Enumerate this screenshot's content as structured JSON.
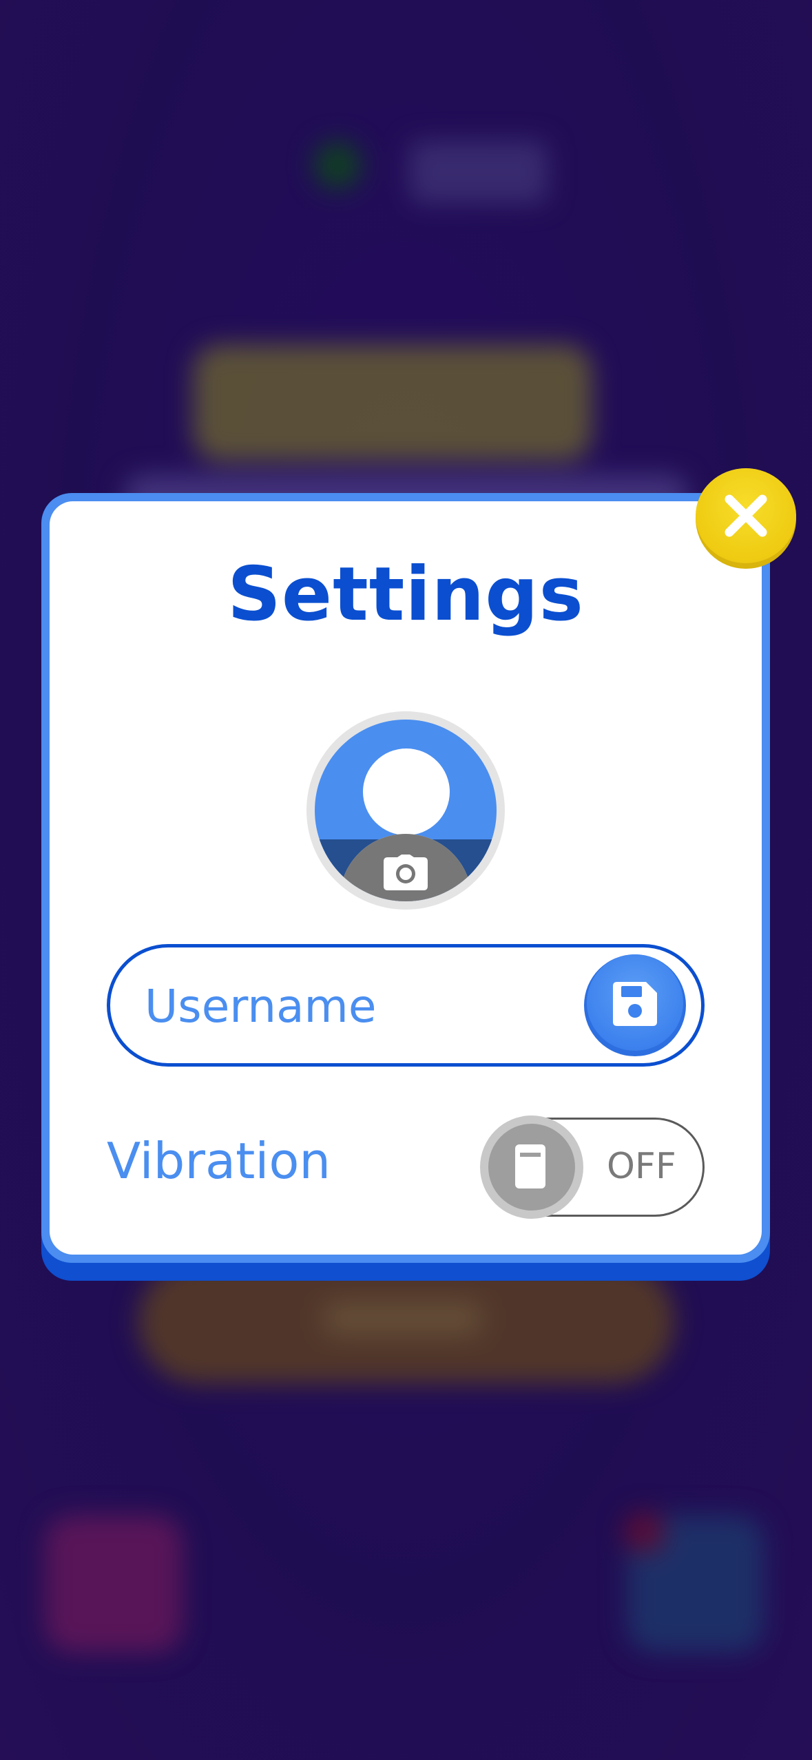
{
  "modal": {
    "title": "Settings",
    "close_icon": "close-x-icon"
  },
  "avatar": {
    "placeholder_icon": "user-silhouette-icon",
    "edit_icon": "camera-icon"
  },
  "username": {
    "placeholder": "Username",
    "value": "",
    "save_icon": "floppy-disk-icon"
  },
  "vibration": {
    "label": "Vibration",
    "state_label": "OFF",
    "enabled": false,
    "knob_icon": "phone-icon"
  },
  "colors": {
    "accent_blue": "#0b4fd0",
    "light_blue": "#4a8ef0",
    "close_yellow": "#efcb12",
    "background_purple": "#25105f"
  }
}
